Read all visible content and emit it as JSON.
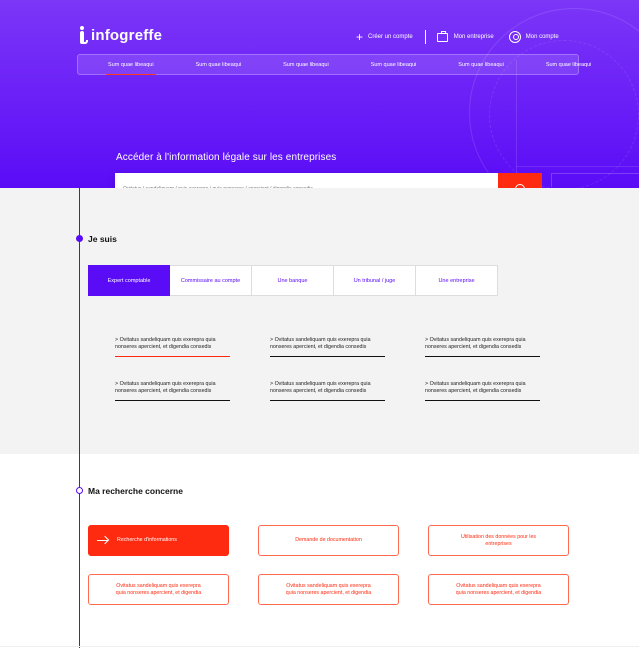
{
  "brand": {
    "name": "infogreffe"
  },
  "topnav": {
    "create_account": "Créer un compte",
    "my_company": "Mon entreprise",
    "my_account": "Mon compte"
  },
  "subnav": {
    "tabs": [
      {
        "label": "Sum quae libeaqui",
        "active": true
      },
      {
        "label": "Sum quae libeaqui",
        "active": false
      },
      {
        "label": "Sum quae libeaqui",
        "active": false
      },
      {
        "label": "Sum quae libeaqui",
        "active": false
      },
      {
        "label": "Sum quae libeaqui",
        "active": false
      },
      {
        "label": "Sum quae libeaqui",
        "active": false
      }
    ]
  },
  "hero": {
    "title": "Accéder à l'information légale sur les entreprises",
    "search_placeholder": "Ovitatus / sandeliquam / quis exerepra / quia nonseres / apercient / digendia consedis"
  },
  "je_suis": {
    "heading": "Je suis",
    "profiles": [
      {
        "label": "Expert comptable",
        "active": true
      },
      {
        "label": "Commissaire au compte",
        "active": false
      },
      {
        "label": "Une banque",
        "active": false
      },
      {
        "label": "Un tribunal / juge",
        "active": false
      },
      {
        "label": "Une entreprise",
        "active": false
      }
    ],
    "links": [
      "> Ovitatus sandeliquam quis exerepra quia nonseres apercient, et digendia consedis",
      "> Ovitatus sandeliquam quis exerepra quia nonseres apercient, et digendia consedis",
      "> Ovitatus sandeliquam quis exerepra quia nonseres apercient, et digendia consedis",
      "> Ovitatus sandeliquam quis exerepra quia nonseres apercient, et digendia consedis",
      "> Ovitatus sandeliquam quis exerepra quia nonseres apercient, et digendia consedis",
      "> Ovitatus sandeliquam quis exerepra quia nonseres apercient, et digendia consedis"
    ]
  },
  "recherche": {
    "heading": "Ma recherche concerne",
    "cards": [
      "Recherche d'informations",
      "Demande de documentation",
      "Utilisation des données pour les entreprises",
      "Ovitatus sandeliquam quis exerepra quia nonseres apercient, et digendia",
      "Ovitatus sandeliquam quis exerepra quia nonseres apercient, et digendia",
      "Ovitatus sandeliquam quis exerepra quia nonseres apercient, et digendia"
    ]
  },
  "colors": {
    "primary": "#5a0cf6",
    "accent": "#ff2b10"
  }
}
